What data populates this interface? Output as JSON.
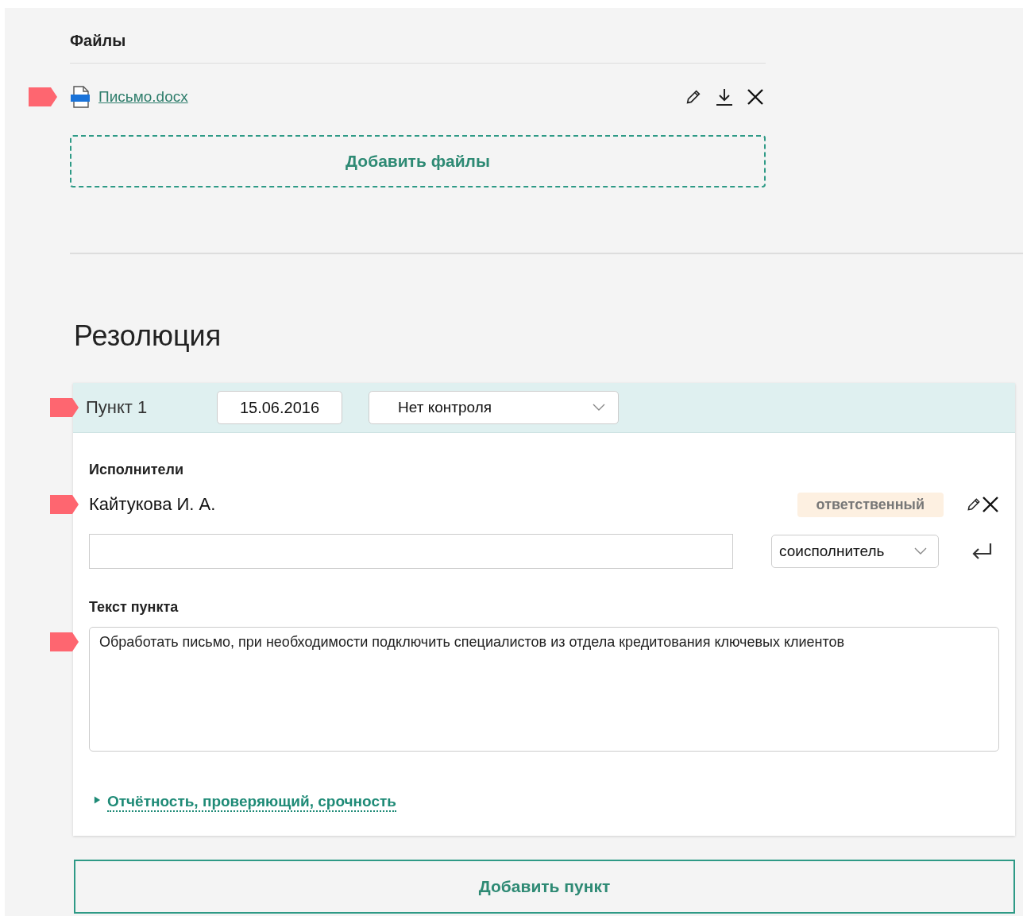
{
  "files": {
    "title": "Файлы",
    "items": [
      {
        "name": "Письмо.docx",
        "flagged": true
      }
    ],
    "add_button": "Добавить файлы"
  },
  "resolution": {
    "title": "Резолюция",
    "items": [
      {
        "title": "Пункт 1",
        "flagged": true,
        "date": "15.06.2016",
        "control": "Нет контроля",
        "executors_label": "Исполнители",
        "executors": [
          {
            "name": "Кайтукова И. А.",
            "role": "ответственный",
            "flagged": true
          }
        ],
        "new_executor": {
          "role": "соисполнитель"
        },
        "text_label": "Текст пункта",
        "text": "Обработать письмо, при необходимости подключить специалистов из отдела кредитования ключевых клиентов",
        "text_flagged": true,
        "more": {
          "label": "Отчётность, проверяющий, срочность",
          "expanded": false
        }
      }
    ],
    "add_button": "Добавить пункт"
  }
}
